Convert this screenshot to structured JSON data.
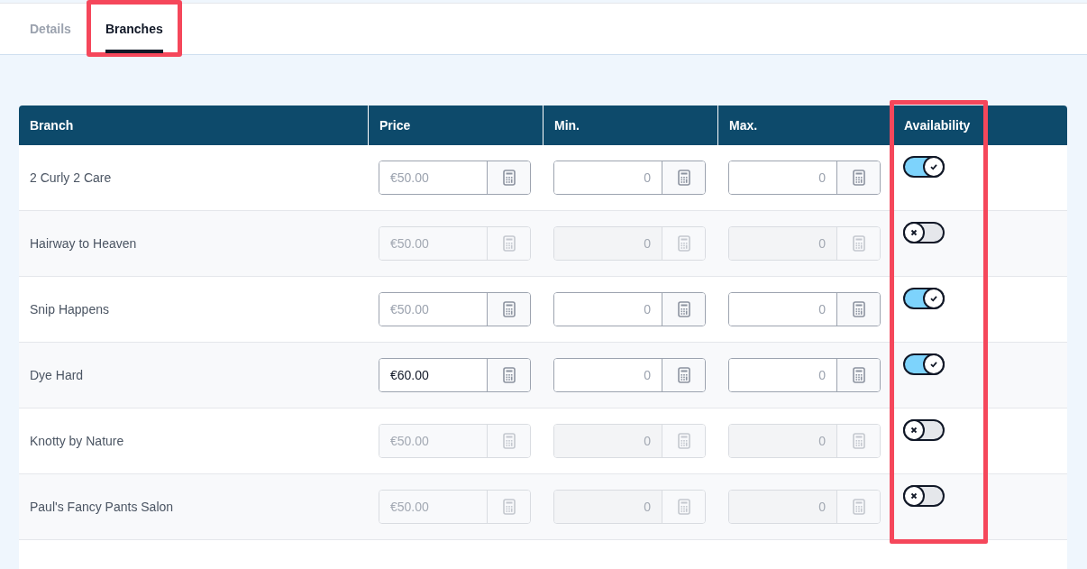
{
  "tabs": [
    {
      "label": "Details",
      "selected": false
    },
    {
      "label": "Branches",
      "selected": true,
      "highlighted": true
    }
  ],
  "table": {
    "columns": [
      {
        "label": "Branch"
      },
      {
        "label": "Price"
      },
      {
        "label": "Min."
      },
      {
        "label": "Max."
      },
      {
        "label": "Availability",
        "highlighted": true
      }
    ],
    "rows": [
      {
        "branch": "2 Curly 2 Care",
        "price": {
          "placeholder": "€50.00"
        },
        "min": {
          "placeholder": "0"
        },
        "max": {
          "placeholder": "0"
        },
        "available": true
      },
      {
        "branch": "Hairway to Heaven",
        "price": {
          "placeholder": "€50.00"
        },
        "min": {
          "placeholder": "0"
        },
        "max": {
          "placeholder": "0"
        },
        "available": false
      },
      {
        "branch": "Snip Happens",
        "price": {
          "placeholder": "€50.00"
        },
        "min": {
          "placeholder": "0"
        },
        "max": {
          "placeholder": "0"
        },
        "available": true
      },
      {
        "branch": "Dye Hard",
        "price": {
          "value": "€60.00"
        },
        "min": {
          "placeholder": "0"
        },
        "max": {
          "placeholder": "0"
        },
        "available": true
      },
      {
        "branch": "Knotty by Nature",
        "price": {
          "placeholder": "€50.00"
        },
        "min": {
          "placeholder": "0"
        },
        "max": {
          "placeholder": "0"
        },
        "available": false
      },
      {
        "branch": "Paul's Fancy Pants Salon",
        "price": {
          "placeholder": "€50.00"
        },
        "min": {
          "placeholder": "0"
        },
        "max": {
          "placeholder": "0"
        },
        "available": false
      }
    ]
  }
}
